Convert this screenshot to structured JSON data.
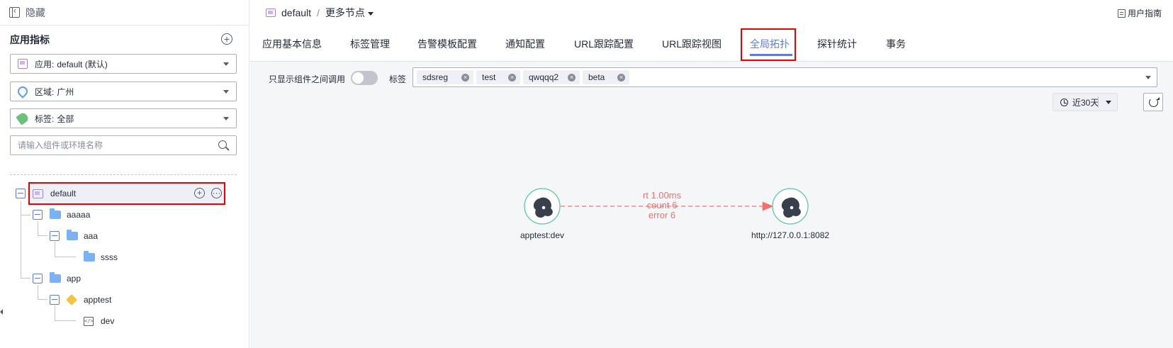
{
  "sidebar": {
    "hide_label": "隐藏",
    "section_title": "应用指标",
    "app_select": {
      "label": "应用:",
      "value": "default (默认)"
    },
    "region_select": {
      "label": "区域:",
      "value": "广州"
    },
    "tag_select": {
      "label": "标签:",
      "value": "全部"
    },
    "search_placeholder": "请输入组件或环境名称",
    "tree": {
      "root": "default",
      "nodes": [
        "aaaaa",
        "aaa",
        "ssss",
        "app",
        "apptest",
        "dev"
      ]
    }
  },
  "header": {
    "breadcrumb_app": "default",
    "breadcrumb_sep": "/",
    "breadcrumb_more": "更多节点",
    "user_guide": "用户指南"
  },
  "tabs": [
    "应用基本信息",
    "标签管理",
    "告警模板配置",
    "通知配置",
    "URL跟踪配置",
    "URL跟踪视图",
    "全局拓扑",
    "探针统计",
    "事务"
  ],
  "active_tab": "全局拓扑",
  "filters": {
    "toggle_label": "只显示组件之间调用",
    "toggle_on": false,
    "tag_label": "标签",
    "tags": [
      "sdsreg",
      "test",
      "qwqqq2",
      "beta"
    ]
  },
  "time_range": "近30天",
  "topology": {
    "source": "apptest:dev",
    "target": "http://127.0.0.1:8082",
    "edge": {
      "rt": "rt 1.00ms",
      "count": "count 6",
      "error": "error 6"
    },
    "edge_color": "#f66f6a",
    "node_color": "#5cc9a7"
  },
  "colors": {
    "accent": "#5e7ce0",
    "highlight": "#ee0000"
  }
}
